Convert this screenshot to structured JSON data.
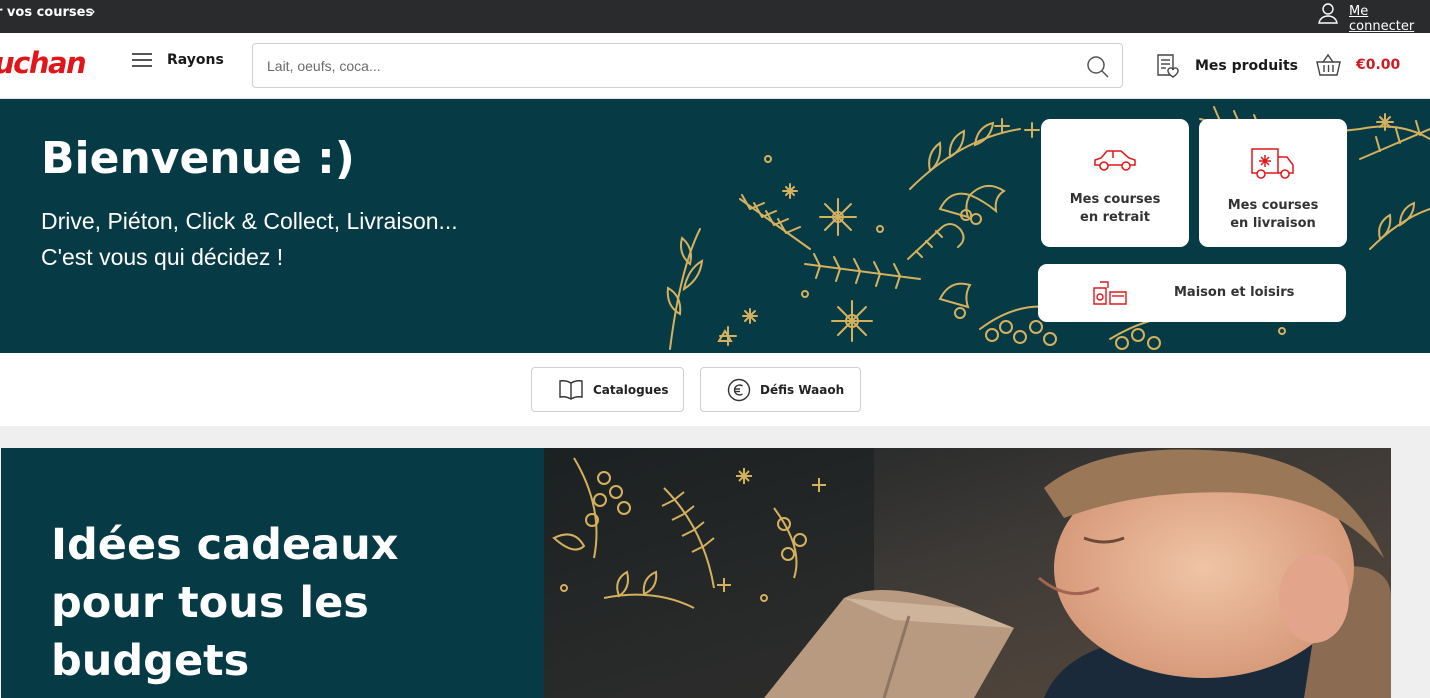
{
  "topbar": {
    "promo_label": "r vos courses",
    "promo_chevron": "›",
    "login_label": "Me connecter"
  },
  "header": {
    "logo_text": "uchan",
    "rayons_label": "Rayons",
    "search_placeholder": "Lait, oeufs, coca...",
    "mes_produits_label": "Mes produits",
    "cart_total": "€0.00"
  },
  "hero": {
    "title": "Bienvenue :)",
    "subtitle_line1": "Drive, Piéton, Click & Collect, Livraison...",
    "subtitle_line2": "C'est vous qui décidez !",
    "cards": [
      {
        "label_line1": "Mes courses",
        "label_line2": "en retrait",
        "icon": "car-icon"
      },
      {
        "label_line1": "Mes courses",
        "label_line2": "en livraison",
        "icon": "delivery-truck-icon"
      },
      {
        "label": "Maison et loisirs",
        "icon": "home-appliances-icon"
      }
    ]
  },
  "quick_links": [
    {
      "label": "Catalogues",
      "icon": "open-book-icon"
    },
    {
      "label": "Défis Waaoh",
      "icon": "euro-coin-icon"
    }
  ],
  "banner": {
    "title": "Idées cadeaux pour tous les budgets"
  },
  "colors": {
    "brand_red": "#e0161b",
    "hero_teal": "#063a45",
    "gold_deco": "#d4b15f",
    "topbar_dark": "#2a2b2d"
  }
}
